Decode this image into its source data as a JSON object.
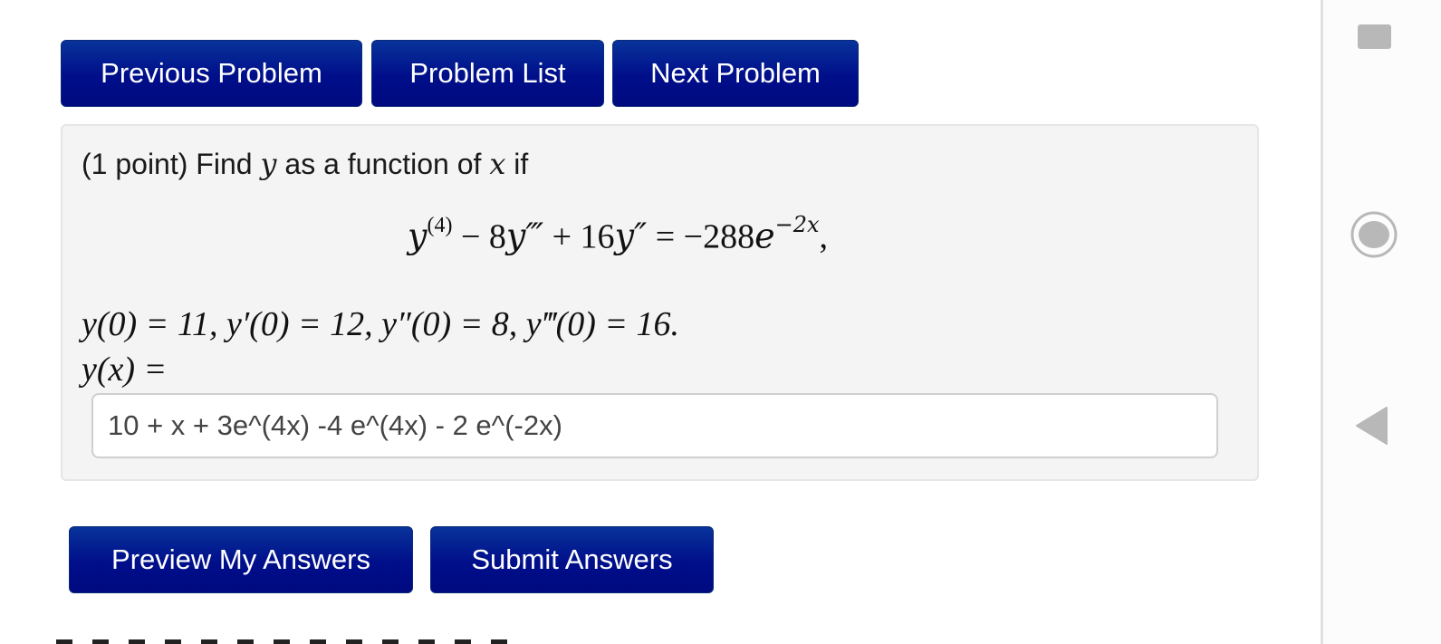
{
  "navigation": {
    "previous_label": "Previous Problem",
    "list_label": "Problem List",
    "next_label": "Next Problem"
  },
  "problem": {
    "points_text": "(1 point) Find",
    "var_y": "y",
    "middle_text": "as a function of",
    "var_x": "x",
    "end_text": "if",
    "equation": {
      "t1": "y",
      "t1_sup": "(4)",
      "t2": " − 8",
      "t2_var": "y‴",
      "t3": " + 16",
      "t3_var": "y″",
      "t4": " = −288",
      "t4_var": "e",
      "t4_sup": "−2x",
      "t5": ","
    },
    "conditions": "y(0) = 11,  y′(0) = 12,  y″(0) = 8,  y‴(0) = 16.",
    "answer_label": "y(x) ="
  },
  "answer": {
    "value": "10 + x + 3e^(4x) -4 e^(4x) - 2 e^(-2x)"
  },
  "actions": {
    "preview_label": "Preview My Answers",
    "submit_label": "Submit Answers"
  },
  "system_nav": {
    "recent_icon": "square-icon",
    "home_icon": "circle-icon",
    "back_icon": "triangle-left-icon"
  }
}
